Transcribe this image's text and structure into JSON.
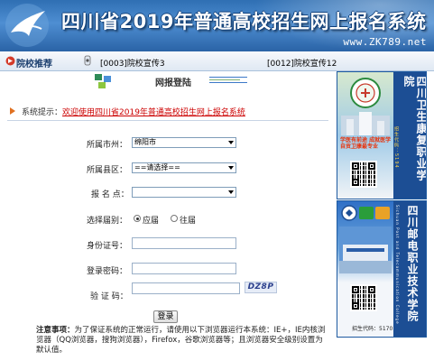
{
  "banner": {
    "title": "四川省2019年普通高校招生网上报名系统",
    "site": "www.ZK789.net"
  },
  "recommend": {
    "label": "院校推荐",
    "items": [
      "[0003]院校宣传3",
      "[0012]院校宣传12"
    ]
  },
  "login": {
    "title": "网报登陆"
  },
  "notice": {
    "label": "系统提示：",
    "message": "欢迎使用四川省2019年普通高校招生网上报名系统"
  },
  "form": {
    "city_label": "所属市州：",
    "city_value": "绵阳市",
    "county_label": "所属县区：",
    "county_value": "==请选择==",
    "site_label": "报 名 点：",
    "site_value": "",
    "type_label": "选择届别：",
    "type_options": [
      "应届",
      "往届"
    ],
    "type_selected": "应届",
    "id_label": "身份证号：",
    "password_label": "登录密码：",
    "captcha_label": "验 证 码：",
    "captcha_image_text": "DZ8P",
    "submit_label": "登录"
  },
  "note": {
    "title": "注意事项：",
    "text": "为了保证系统的正常运行，请使用以下浏览器运行本系统：IE+，IE内核浏览器（QQ浏览器，搜狗浏览器），Firefox，谷歌浏览器等；且浏览器安全级别设置为默认值。"
  },
  "ads": [
    {
      "name": "四川卫生康复职业学院",
      "vertical_text": "四川卫生康复职业学院",
      "slogan": "学医有前途 成就医学 自贡卫康最专业",
      "code_text": "招生代码：5194"
    },
    {
      "name": "四川邮电职业技术学院",
      "vertical_text": "四川邮电职业技术学院",
      "english": "Sichuan Post and Telecommunication College",
      "code_text": "招生代码：5170"
    }
  ],
  "colors": {
    "banner_blue": "#2f6fb3",
    "notice_red": "#cc0000",
    "ad_navy": "#1c4e94"
  }
}
